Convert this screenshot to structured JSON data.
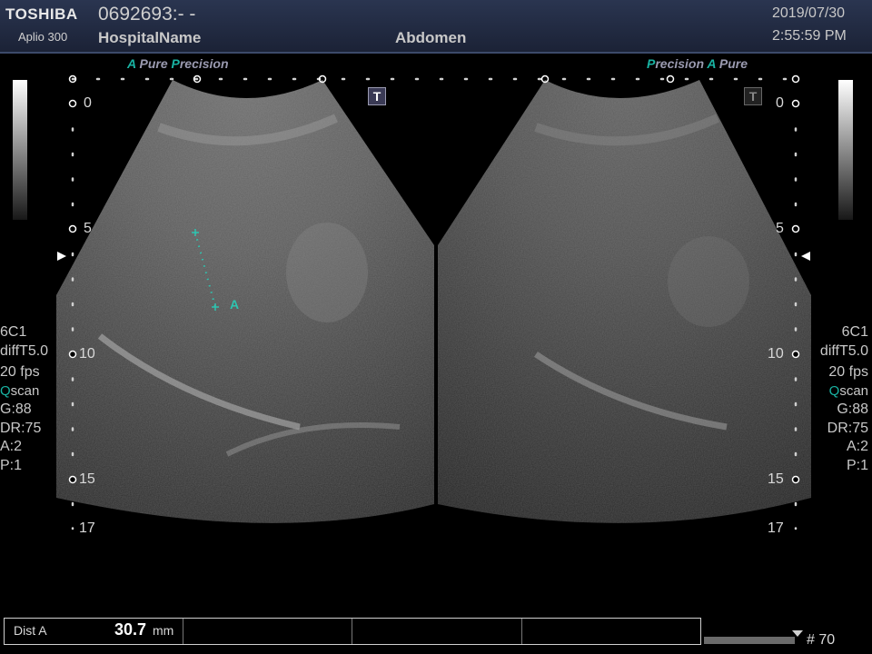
{
  "header": {
    "brand": "TOSHIBA",
    "model": "Aplio 300",
    "patient_id": "0692693:- -",
    "hospital": "HospitalName",
    "exam": "Abdomen",
    "date": "2019/07/30",
    "time": "2:55:59 PM"
  },
  "left_panel": {
    "tag_a": "A",
    "tag_pure": "Pure",
    "tag_p": "P",
    "tag_precision": "recision",
    "depth_labels": [
      "0",
      "5",
      "10",
      "15",
      "17"
    ],
    "probe": "6C1",
    "filter": "diffT5.0",
    "fps": "20 fps",
    "qscan_q": "Q",
    "qscan_rest": "scan",
    "gain": "G:88",
    "dr": "DR:75",
    "a": "A:2",
    "p": "P:1",
    "badge": "T",
    "marker_label": "A"
  },
  "right_panel": {
    "tag_p": "P",
    "tag_precision": "recision",
    "tag_a": "A",
    "tag_pure": "Pure",
    "depth_labels": [
      "0",
      "5",
      "10",
      "15",
      "17"
    ],
    "probe": "6C1",
    "filter": "diffT5.0",
    "fps": "20 fps",
    "qscan_q": "Q",
    "qscan_rest": "scan",
    "gain": "G:88",
    "dr": "DR:75",
    "a": "A:2",
    "p": "P:1",
    "badge": "T"
  },
  "measurement": {
    "label": "Dist A",
    "value": "30.7",
    "unit": "mm"
  },
  "footer": {
    "frame": "# 70"
  }
}
